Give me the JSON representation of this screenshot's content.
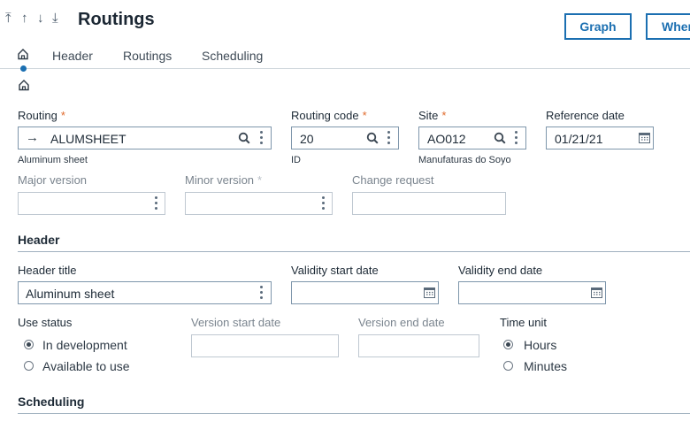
{
  "header": {
    "nav_arrows": [
      "⤒",
      "↑",
      "↓",
      "⤓"
    ],
    "title": "Routings",
    "buttons": {
      "graph": "Graph",
      "where": "Where"
    }
  },
  "tabs": [
    "Header",
    "Routings",
    "Scheduling"
  ],
  "form": {
    "routing": {
      "label": "Routing",
      "value": "ALUMSHEET",
      "description": "Aluminum sheet"
    },
    "routing_code": {
      "label": "Routing code",
      "value": "20",
      "description": "ID"
    },
    "site": {
      "label": "Site",
      "value": "AO012",
      "description": "Manufaturas do Soyo"
    },
    "reference_date": {
      "label": "Reference date",
      "value": "01/21/21"
    },
    "major_version": {
      "label": "Major version",
      "value": ""
    },
    "minor_version": {
      "label": "Minor version",
      "value": ""
    },
    "change_request": {
      "label": "Change request",
      "value": ""
    }
  },
  "header_section": {
    "title": "Header",
    "header_title": {
      "label": "Header title",
      "value": "Aluminum sheet"
    },
    "validity_start": {
      "label": "Validity start date",
      "value": ""
    },
    "validity_end": {
      "label": "Validity end date",
      "value": ""
    },
    "use_status": {
      "label": "Use status",
      "options": [
        "In development",
        "Available to use"
      ],
      "selected": "In development"
    },
    "version_start": {
      "label": "Version start date",
      "value": ""
    },
    "version_end": {
      "label": "Version end date",
      "value": ""
    },
    "time_unit": {
      "label": "Time unit",
      "options": [
        "Hours",
        "Minutes"
      ],
      "selected": "Hours"
    }
  },
  "scheduling_section": {
    "title": "Scheduling"
  },
  "colors": {
    "accent": "#1b6fb1",
    "required": "#e06a2c"
  }
}
